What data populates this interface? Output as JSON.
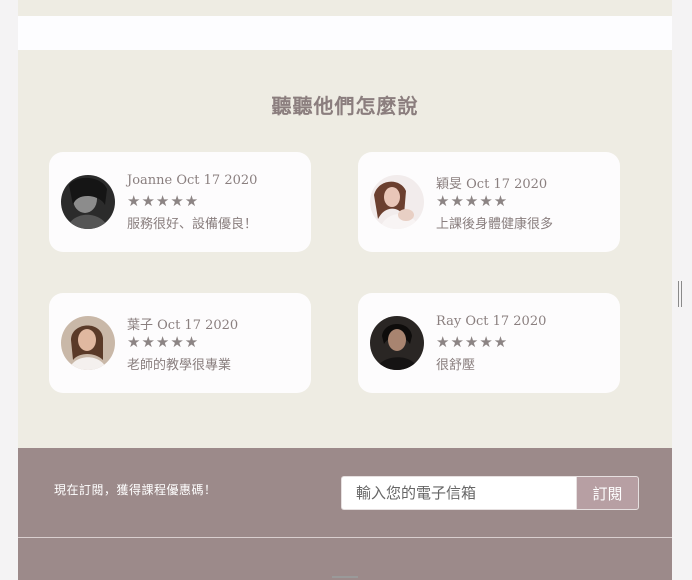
{
  "section": {
    "title": "聽聽他們怎麼說"
  },
  "testimonials": [
    {
      "name": "Joanne Oct 17 2020",
      "stars": "★★★★★",
      "rating": 5,
      "comment": "服務很好、設備優良！"
    },
    {
      "name": "穎旻 Oct 17 2020",
      "stars": "★★★★★",
      "rating": 5,
      "comment": "上課後身體健康很多"
    },
    {
      "name": "葉子 Oct 17 2020",
      "stars": "★★★★★",
      "rating": 5,
      "comment": "老師的教學很專業"
    },
    {
      "name": "Ray Oct 17 2020",
      "stars": "★★★★★",
      "rating": 5,
      "comment": "很舒壓"
    }
  ],
  "footer": {
    "promo": "現在訂閱，獲得課程優惠碼！",
    "email_placeholder": "輸入您的電子信箱",
    "subscribe_label": "訂閱"
  },
  "colors": {
    "background": "#eeece3",
    "card": "#fdfcfd",
    "text": "#8a7f7f",
    "footer": "#9c8a8a",
    "button": "#b79fa3"
  }
}
